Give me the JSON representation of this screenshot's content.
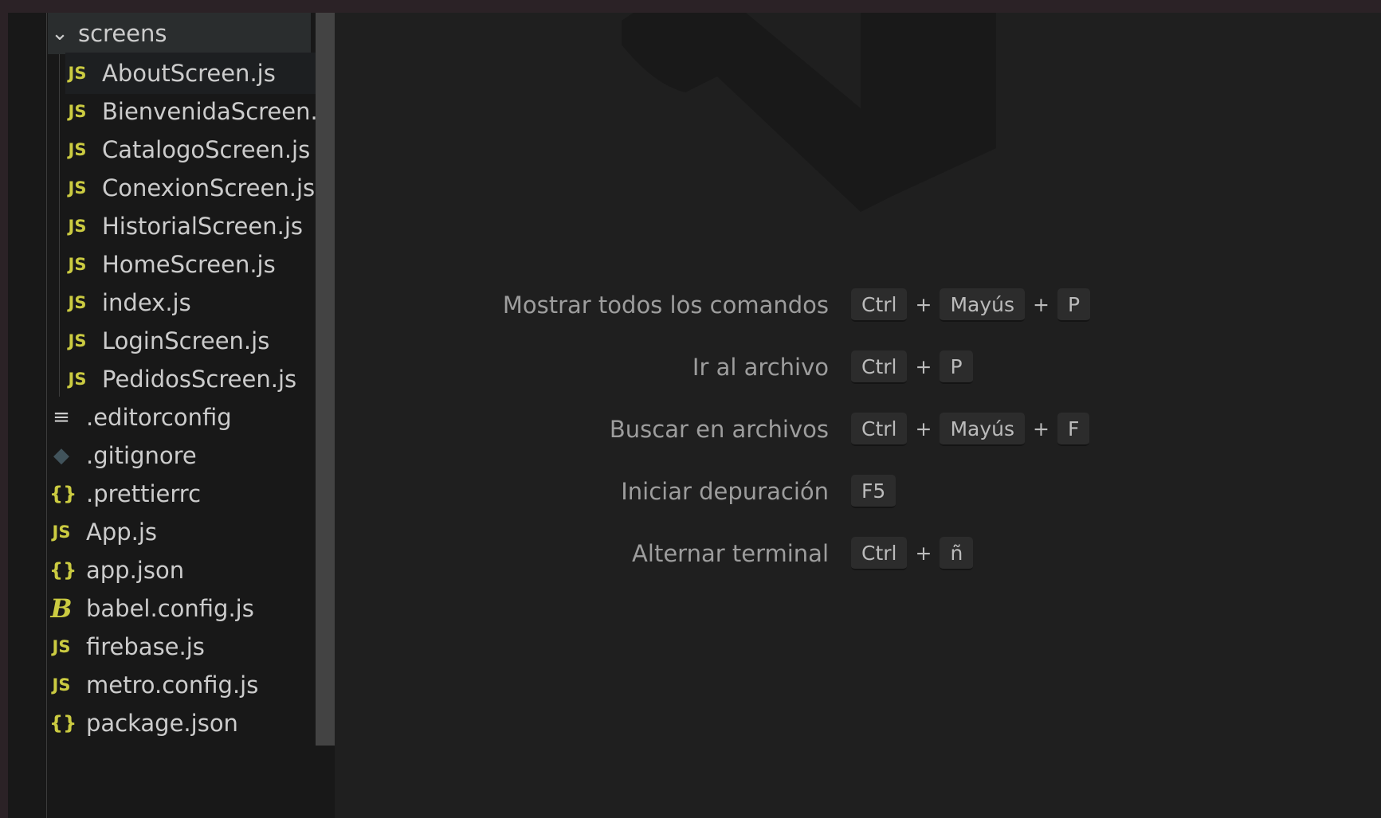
{
  "explorer": {
    "folder": {
      "label": "screens",
      "chevron": "chevron-down-icon"
    },
    "screens_files": [
      {
        "label": "AboutScreen.js",
        "icon": "js-icon"
      },
      {
        "label": "BienvenidaScreen.js",
        "icon": "js-icon"
      },
      {
        "label": "CatalogoScreen.js",
        "icon": "js-icon"
      },
      {
        "label": "ConexionScreen.js",
        "icon": "js-icon"
      },
      {
        "label": "HistorialScreen.js",
        "icon": "js-icon"
      },
      {
        "label": "HomeScreen.js",
        "icon": "js-icon"
      },
      {
        "label": "index.js",
        "icon": "js-icon"
      },
      {
        "label": "LoginScreen.js",
        "icon": "js-icon"
      },
      {
        "label": "PedidosScreen.js",
        "icon": "js-icon"
      }
    ],
    "root_files": [
      {
        "label": ".editorconfig",
        "icon": "config-lines-icon"
      },
      {
        "label": ".gitignore",
        "icon": "git-icon"
      },
      {
        "label": ".prettierrc",
        "icon": "json-icon"
      },
      {
        "label": "App.js",
        "icon": "js-icon"
      },
      {
        "label": "app.json",
        "icon": "json-icon"
      },
      {
        "label": "babel.config.js",
        "icon": "babel-icon"
      },
      {
        "label": "firebase.js",
        "icon": "js-icon"
      },
      {
        "label": "metro.config.js",
        "icon": "js-icon"
      },
      {
        "label": "package.json",
        "icon": "json-icon"
      }
    ]
  },
  "icon_glyphs": {
    "js": "JS",
    "json": "{}",
    "babel": "B",
    "cfg": "≡",
    "git": "◆",
    "chevron": "⌄"
  },
  "shortcuts": [
    {
      "label": "Mostrar todos los comandos",
      "keys": [
        "Ctrl",
        "Mayús",
        "P"
      ]
    },
    {
      "label": "Ir al archivo",
      "keys": [
        "Ctrl",
        "P"
      ]
    },
    {
      "label": "Buscar en archivos",
      "keys": [
        "Ctrl",
        "Mayús",
        "F"
      ]
    },
    {
      "label": "Iniciar depuración",
      "keys": [
        "F5"
      ]
    },
    {
      "label": "Alternar terminal",
      "keys": [
        "Ctrl",
        "ñ"
      ]
    }
  ],
  "key_separator": "+",
  "colors": {
    "js_icon": "#cbcb41",
    "text": "#cccccc",
    "shortcut_label": "#9d9d9d",
    "editor_bg": "#1f1f1f",
    "sidebar_bg": "#181818"
  }
}
